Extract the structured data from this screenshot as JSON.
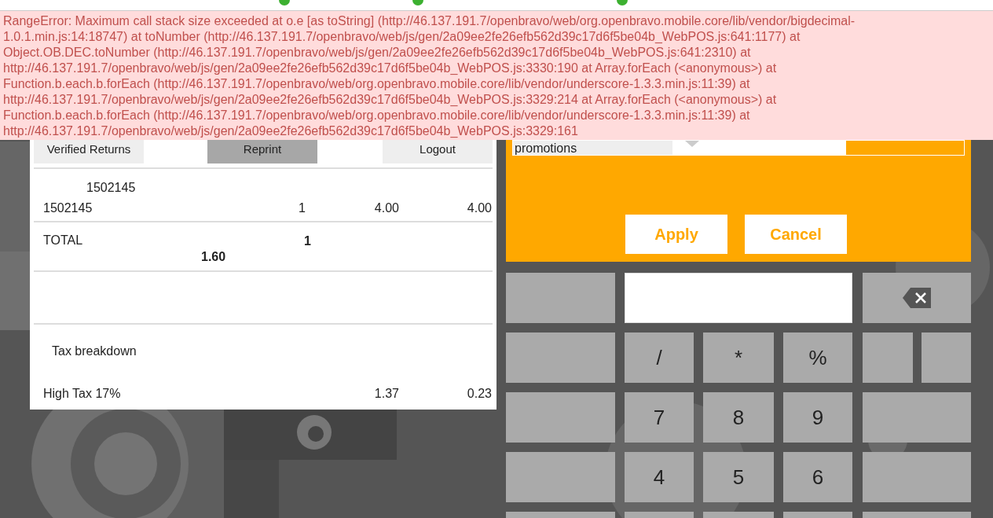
{
  "error": {
    "lines": [
      "RangeError: Maximum call stack size exceeded at o.e [as toString] (http://46.137.191.7/openbravo/web/org.openbravo.mobile.core/lib/vendor/bigdecimal-",
      "1.0.1.min.js:14:18747) at toNumber (http://46.137.191.7/openbravo/web/js/gen/2a09ee2fe26efb562d39c17d6f5be04b_WebPOS.js:641:1177) at",
      "Object.OB.DEC.toNumber (http://46.137.191.7/openbravo/web/js/gen/2a09ee2fe26efb562d39c17d6f5be04b_WebPOS.js:641:2310) at",
      "http://46.137.191.7/openbravo/web/js/gen/2a09ee2fe26efb562d39c17d6f5be04b_WebPOS.js:3330:190 at Array.forEach (<anonymous>) at",
      "Function.b.each.b.forEach (http://46.137.191.7/openbravo/web/org.openbravo.mobile.core/lib/vendor/underscore-1.3.3.min.js:11:39) at",
      "http://46.137.191.7/openbravo/web/js/gen/2a09ee2fe26efb562d39c17d6f5be04b_WebPOS.js:3329:214 at Array.forEach (<anonymous>) at",
      "Function.b.each.b.forEach (http://46.137.191.7/openbravo/web/org.openbravo.mobile.core/lib/vendor/underscore-1.3.3.min.js:11:39) at",
      "http://46.137.191.7/openbravo/web/js/gen/2a09ee2fe26efb562d39c17d6f5be04b_WebPOS.js:3329:161"
    ]
  },
  "receipt": {
    "actions": [
      {
        "label": "Verified Returns",
        "selected": false
      },
      {
        "label": "Reprint",
        "selected": true
      },
      {
        "label": "Logout",
        "selected": false
      }
    ],
    "line_ref": "1502145",
    "lines": [
      {
        "product": "1502145",
        "qty": "1",
        "price": "4.00",
        "amount": "4.00"
      }
    ],
    "total": {
      "label": "TOTAL",
      "qty": "1",
      "amount": "1.60"
    },
    "tax_heading": "Tax breakdown",
    "taxes": [
      {
        "name": "High Tax 17%",
        "base": "1.37",
        "amount": "0.23"
      }
    ]
  },
  "promotion_dialog": {
    "select": "promotions",
    "buttons": [
      "Apply",
      "Cancel"
    ]
  },
  "keypad": {
    "rows": [
      [
        {
          "kind": "blank"
        },
        {
          "kind": "input"
        },
        {
          "kind": "backspace"
        }
      ],
      [
        {
          "kind": "blank"
        },
        {
          "kind": "key",
          "label": "/"
        },
        {
          "kind": "key",
          "label": "*"
        },
        {
          "kind": "key",
          "label": "%"
        },
        {
          "kind": "blank"
        },
        {
          "kind": "blank"
        }
      ],
      [
        {
          "kind": "blank"
        },
        {
          "kind": "key",
          "label": "7"
        },
        {
          "kind": "key",
          "label": "8"
        },
        {
          "kind": "key",
          "label": "9"
        },
        {
          "kind": "wide"
        }
      ],
      [
        {
          "kind": "blank"
        },
        {
          "kind": "key",
          "label": "4"
        },
        {
          "kind": "key",
          "label": "5"
        },
        {
          "kind": "key",
          "label": "6"
        },
        {
          "kind": "wide"
        }
      ],
      [
        {
          "kind": "blank"
        },
        {
          "kind": "blank"
        },
        {
          "kind": "blank"
        },
        {
          "kind": "blank"
        },
        {
          "kind": "wide"
        }
      ]
    ]
  }
}
